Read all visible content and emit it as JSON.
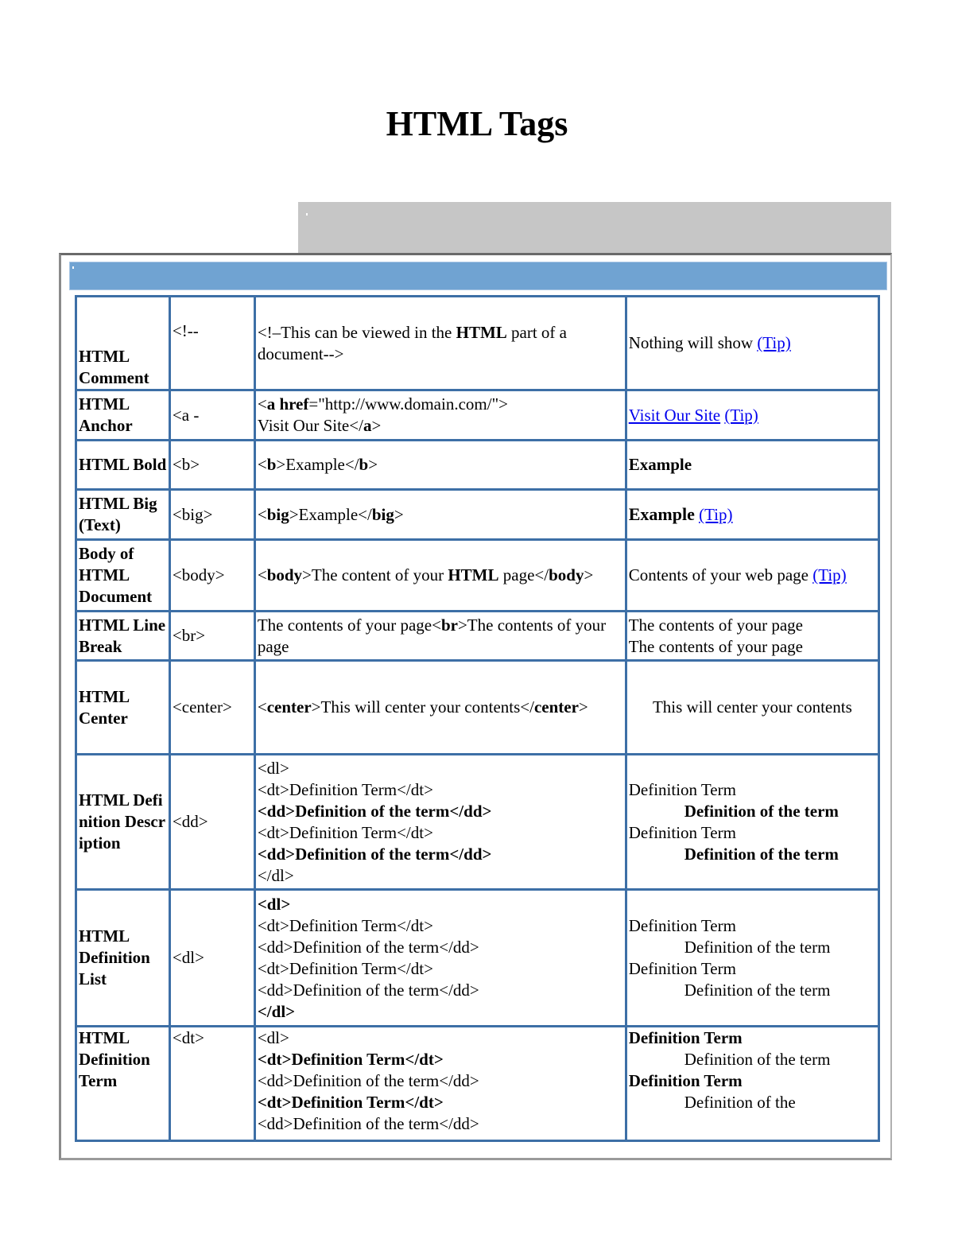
{
  "title": "HTML Tags",
  "rows": [
    {
      "name": "HTML Comment",
      "tag": "<!--",
      "example": {
        "pre": "<!–This can be viewed in the ",
        "bold": "HTML",
        "post": " part of a document-->"
      },
      "result": {
        "text": "Nothing will show ",
        "tip": "(Tip)"
      }
    },
    {
      "name": "HTML Anchor",
      "tag": "<a -",
      "example": {
        "l1a": "<",
        "l1b": "a href",
        "l1c": "=\"http://www.domain.com/\">",
        "l2a": "Visit Our Site</",
        "l2b": "a",
        "l2c": ">"
      },
      "result": {
        "link": "Visit Our Site",
        "tip": "(Tip)"
      }
    },
    {
      "name": "HTML Bold",
      "tag": "<b>",
      "example": {
        "a": "<",
        "b": "b",
        "c": ">Example</",
        "d": "b",
        "e": ">"
      },
      "result": {
        "text": "Example"
      }
    },
    {
      "name": "HTML Big (Text)",
      "tag": "<big>",
      "example": {
        "a": "<",
        "b": "big",
        "c": ">Example</",
        "d": "big",
        "e": ">"
      },
      "result": {
        "text": "Example",
        "tip": "(Tip)"
      }
    },
    {
      "name": "Body of HTML Document",
      "tag": "<body>",
      "example": {
        "a": "<",
        "b": "body",
        "c": ">The content of your ",
        "d": "HTML",
        "e": " page</",
        "f": "body",
        "g": ">"
      },
      "result": {
        "text": "Contents of your web page ",
        "tip": "(Tip)"
      }
    },
    {
      "name": "HTML Line Break",
      "tag": "<br>",
      "example": {
        "a": "The contents of your page<",
        "b": "br",
        "c": ">The contents of your page"
      },
      "result": {
        "line1": "The contents of your page",
        "line2": "The contents of your page"
      }
    },
    {
      "name": "HTML Center",
      "tag": "<center>",
      "example": {
        "a": "<",
        "b": "center",
        "c": ">This will center your contents</",
        "d": "center",
        "e": ">"
      },
      "result": {
        "text": "This will center your contents"
      }
    },
    {
      "name": "HTML Definition Description",
      "tag": "<dd>",
      "example_lines": [
        "<dl>",
        "<dt>Definition Term</dt>",
        "<dd>Definition of the term</dd>",
        "<dt>Definition Term</dt>",
        "<dd>Definition of the term</dd>",
        "</dl>"
      ],
      "result": {
        "term": "Definition Term",
        "definition": "Definition of the term"
      }
    },
    {
      "name": "HTML Definition List",
      "tag": "<dl>",
      "example_lines": [
        "<dl>",
        "<dt>Definition Term</dt>",
        "<dd>Definition of the term</dd>",
        "<dt>Definition Term</dt>",
        "<dd>Definition of the term</dd>",
        "</dl>"
      ],
      "result": {
        "term": "Definition Term",
        "definition": "Definition of the term"
      }
    },
    {
      "name": "HTML Definition Term",
      "tag": "<dt>",
      "example_lines": [
        "<dl>",
        "<dt>Definition Term</dt>",
        "<dd>Definition of the term</dd>",
        "<dt>Definition Term</dt>",
        "<dd>Definition of the term</dd>"
      ],
      "result": {
        "term": "Definition Term",
        "definition": "Definition of the term",
        "definition_cut": "Definition of the"
      }
    }
  ]
}
